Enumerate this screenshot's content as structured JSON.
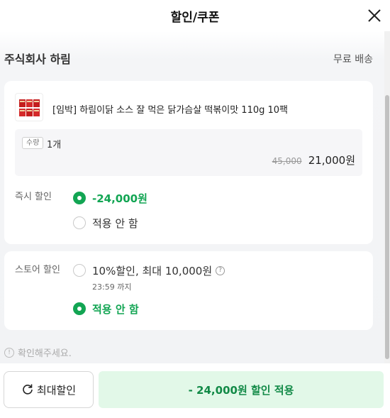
{
  "header": {
    "title": "할인/쿠폰",
    "close_icon": "close-icon"
  },
  "store": {
    "name": "주식회사 하림",
    "shipping": "무료 배송"
  },
  "product": {
    "name": "[임박] 하림이닭 소스 잘 먹은 닭가슴살 떡볶이맛 110g 10팩",
    "quantity_tag": "수량",
    "quantity": "1개",
    "original_price": "45,000",
    "final_price": "21,000원"
  },
  "instant_discount": {
    "label": "즉시 할인",
    "options": [
      {
        "text": "-24,000원",
        "selected": true
      },
      {
        "text": "적용 안 함",
        "selected": false
      }
    ]
  },
  "store_discount": {
    "label": "스토어 할인",
    "options": [
      {
        "text": "10%할인, 최대 10,000원",
        "sub": "23:59 까지",
        "selected": false
      },
      {
        "text": "적용 안 함",
        "selected": true
      }
    ],
    "help_icon": "question-icon"
  },
  "notice": {
    "text": "확인해주세요."
  },
  "footer": {
    "max_discount_label": "최대할인",
    "apply_label": "- 24,000원 할인 적용"
  },
  "colors": {
    "accent": "#12a553",
    "apply_bg": "#e2f8e8",
    "apply_text": "#128a47"
  }
}
